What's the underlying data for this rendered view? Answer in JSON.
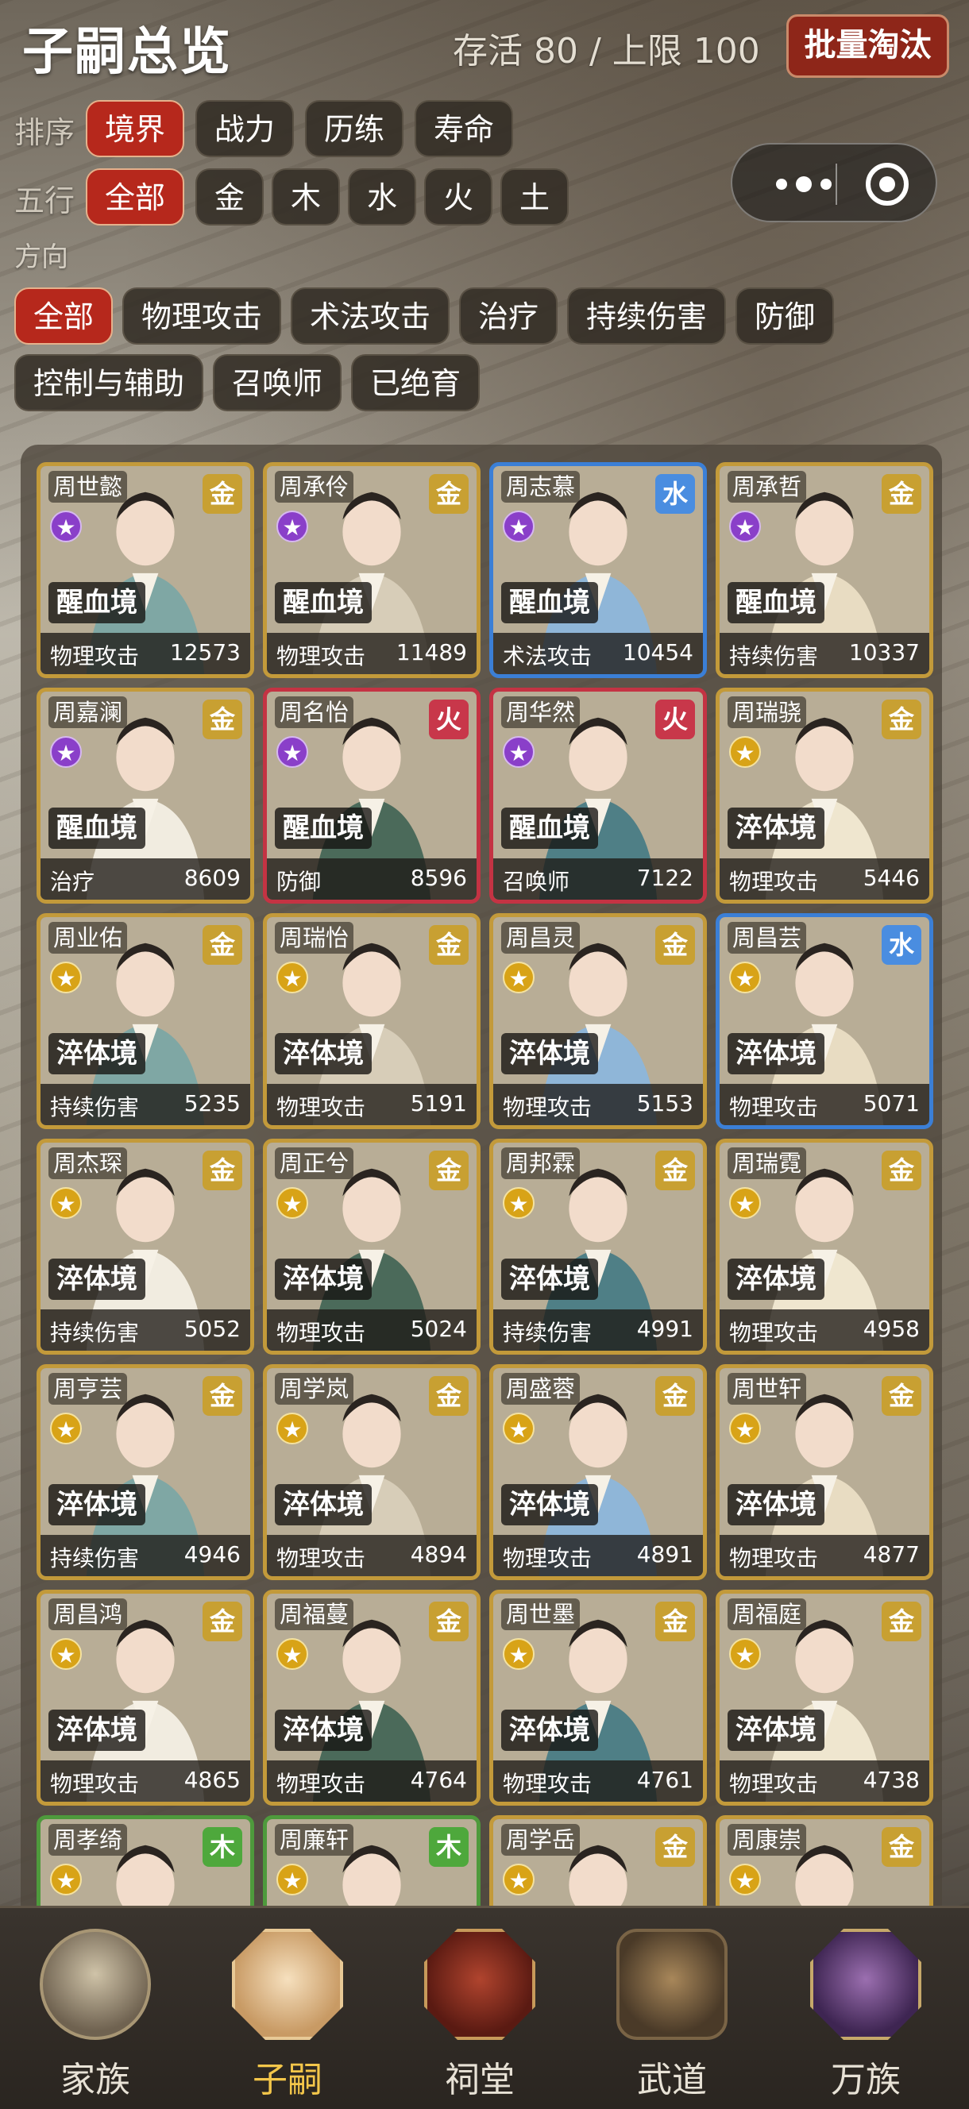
{
  "header": {
    "title": "子嗣总览",
    "capacity": "存活 80 / 上限 100",
    "cull_button": "批量淘汰"
  },
  "filters": {
    "sort": {
      "label": "排序",
      "options": [
        "境界",
        "战力",
        "历练",
        "寿命"
      ],
      "active": "境界"
    },
    "element": {
      "label": "五行",
      "options": [
        "全部",
        "金",
        "木",
        "水",
        "火",
        "土"
      ],
      "active": "全部"
    },
    "direction": {
      "label": "方向",
      "options": [
        "全部",
        "物理攻击",
        "术法攻击",
        "治疗",
        "持续伤害",
        "防御",
        "控制与辅助",
        "召唤师",
        "已绝育"
      ],
      "active": "全部"
    }
  },
  "cards": [
    {
      "name": "周世懿",
      "element": "金",
      "realm": "醒血境",
      "role": "物理攻击",
      "power": "12573",
      "star": "purple"
    },
    {
      "name": "周承伶",
      "element": "金",
      "realm": "醒血境",
      "role": "物理攻击",
      "power": "11489",
      "star": "purple"
    },
    {
      "name": "周志慕",
      "element": "水",
      "realm": "醒血境",
      "role": "术法攻击",
      "power": "10454",
      "star": "purple"
    },
    {
      "name": "周承哲",
      "element": "金",
      "realm": "醒血境",
      "role": "持续伤害",
      "power": "10337",
      "star": "purple"
    },
    {
      "name": "周嘉澜",
      "element": "金",
      "realm": "醒血境",
      "role": "治疗",
      "power": "8609",
      "star": "purple"
    },
    {
      "name": "周名怡",
      "element": "火",
      "realm": "醒血境",
      "role": "防御",
      "power": "8596",
      "star": "purple"
    },
    {
      "name": "周华然",
      "element": "火",
      "realm": "醒血境",
      "role": "召唤师",
      "power": "7122",
      "star": "purple"
    },
    {
      "name": "周瑞骁",
      "element": "金",
      "realm": "淬体境",
      "role": "物理攻击",
      "power": "5446",
      "star": "gold"
    },
    {
      "name": "周业佑",
      "element": "金",
      "realm": "淬体境",
      "role": "持续伤害",
      "power": "5235",
      "star": "gold"
    },
    {
      "name": "周瑞怡",
      "element": "金",
      "realm": "淬体境",
      "role": "物理攻击",
      "power": "5191",
      "star": "gold"
    },
    {
      "name": "周昌灵",
      "element": "金",
      "realm": "淬体境",
      "role": "物理攻击",
      "power": "5153",
      "star": "gold"
    },
    {
      "name": "周昌芸",
      "element": "水",
      "realm": "淬体境",
      "role": "物理攻击",
      "power": "5071",
      "star": "gold"
    },
    {
      "name": "周杰琛",
      "element": "金",
      "realm": "淬体境",
      "role": "持续伤害",
      "power": "5052",
      "star": "gold"
    },
    {
      "name": "周正兮",
      "element": "金",
      "realm": "淬体境",
      "role": "物理攻击",
      "power": "5024",
      "star": "gold"
    },
    {
      "name": "周邦霖",
      "element": "金",
      "realm": "淬体境",
      "role": "持续伤害",
      "power": "4991",
      "star": "gold"
    },
    {
      "name": "周瑞霓",
      "element": "金",
      "realm": "淬体境",
      "role": "物理攻击",
      "power": "4958",
      "star": "gold"
    },
    {
      "name": "周亨芸",
      "element": "金",
      "realm": "淬体境",
      "role": "持续伤害",
      "power": "4946",
      "star": "gold"
    },
    {
      "name": "周学岚",
      "element": "金",
      "realm": "淬体境",
      "role": "物理攻击",
      "power": "4894",
      "star": "gold"
    },
    {
      "name": "周盛蓉",
      "element": "金",
      "realm": "淬体境",
      "role": "物理攻击",
      "power": "4891",
      "star": "gold"
    },
    {
      "name": "周世轩",
      "element": "金",
      "realm": "淬体境",
      "role": "物理攻击",
      "power": "4877",
      "star": "gold"
    },
    {
      "name": "周昌鸿",
      "element": "金",
      "realm": "淬体境",
      "role": "物理攻击",
      "power": "4865",
      "star": "gold"
    },
    {
      "name": "周福蔓",
      "element": "金",
      "realm": "淬体境",
      "role": "物理攻击",
      "power": "4764",
      "star": "gold"
    },
    {
      "name": "周世墨",
      "element": "金",
      "realm": "淬体境",
      "role": "物理攻击",
      "power": "4761",
      "star": "gold"
    },
    {
      "name": "周福庭",
      "element": "金",
      "realm": "淬体境",
      "role": "物理攻击",
      "power": "4738",
      "star": "gold"
    },
    {
      "name": "周孝绮",
      "element": "木",
      "realm": "",
      "role": "",
      "power": "",
      "star": "gold"
    },
    {
      "name": "周廉轩",
      "element": "木",
      "realm": "",
      "role": "",
      "power": "",
      "star": "gold"
    },
    {
      "name": "周学岳",
      "element": "金",
      "realm": "",
      "role": "",
      "power": "",
      "star": "gold"
    },
    {
      "name": "周康崇",
      "element": "金",
      "realm": "",
      "role": "",
      "power": "",
      "star": "gold"
    }
  ],
  "nav": {
    "items": [
      {
        "label": "家族",
        "icon": "dragon-hall-icon"
      },
      {
        "label": "子嗣",
        "icon": "children-icon"
      },
      {
        "label": "祠堂",
        "icon": "ancestral-hall-icon"
      },
      {
        "label": "武道",
        "icon": "martial-swords-icon"
      },
      {
        "label": "万族",
        "icon": "clan-palace-icon"
      }
    ],
    "active": "子嗣"
  },
  "colors": {
    "accent_red": "#b6281c",
    "gold_border": "#c39a3a",
    "water_border": "#3b7fd6",
    "fire_border": "#c43343",
    "wood_border": "#4e9a3c",
    "nav_active": "#f3c64a"
  }
}
